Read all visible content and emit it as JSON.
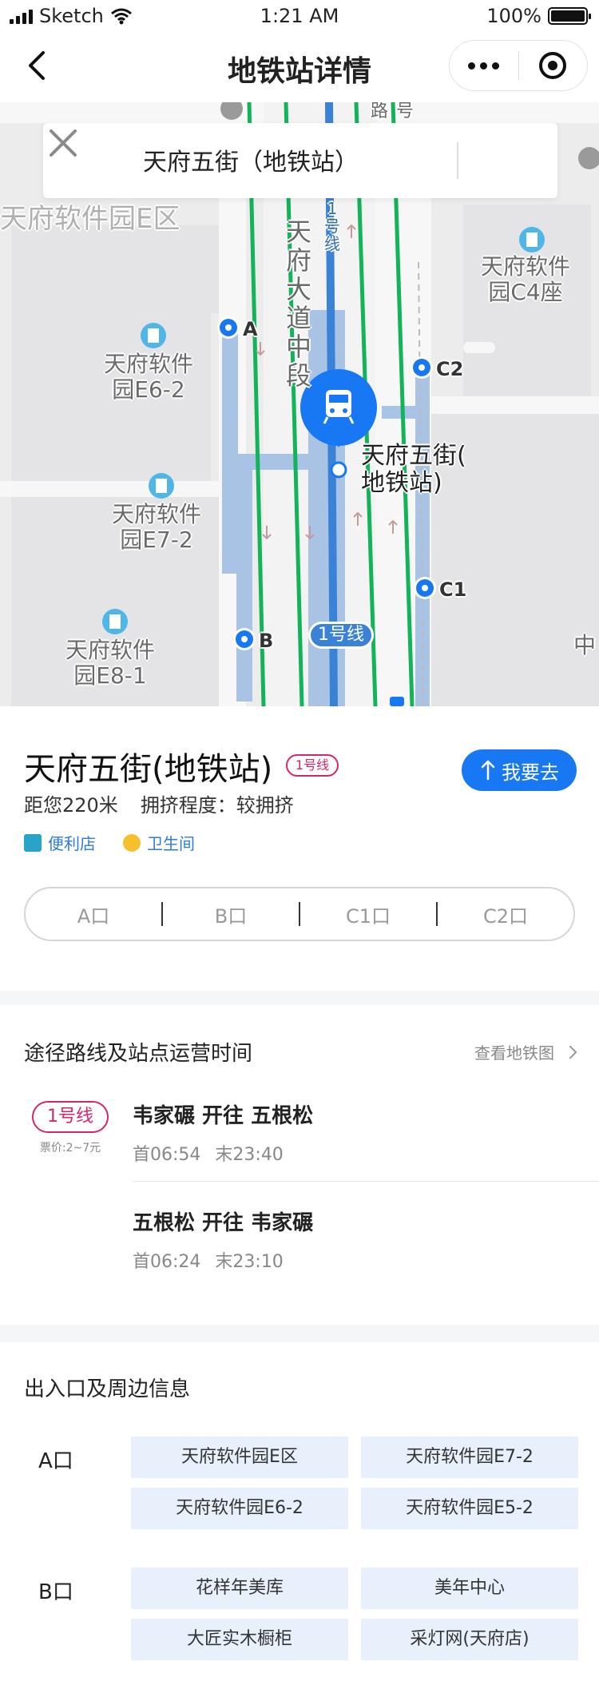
{
  "status_bar": {
    "carrier": "Sketch",
    "time": "1:21 AM",
    "battery": "100%"
  },
  "nav": {
    "title": "地铁站详情"
  },
  "map": {
    "search_text": "天府五街（地铁站）",
    "labels": {
      "park_e": "天府软件园E区",
      "c4": [
        "天府软件",
        "园C4座"
      ],
      "e6": [
        "天府软件",
        "园E6-2"
      ],
      "e7": [
        "天府软件",
        "园E7-2"
      ],
      "e8": [
        "天府软件",
        "园E8-1"
      ],
      "avenue": [
        "天",
        "府",
        "大",
        "道",
        "中",
        "段"
      ],
      "station": [
        "天府五街(",
        "地铁站)"
      ],
      "line_vertical": [
        "1",
        "号",
        "线"
      ],
      "road_top": [
        "路",
        "号"
      ],
      "edge_right": "中"
    },
    "exits": {
      "a": "A",
      "b": "B",
      "c1": "C1",
      "c2": "C2"
    },
    "line_tag": "1号线"
  },
  "station": {
    "name": "天府五街(地铁站)",
    "line_badge": "1号线",
    "go_label": "我要去",
    "distance": "距您220米",
    "crowd": "拥挤程度：较拥挤",
    "facilities": [
      "便利店",
      "卫生间"
    ],
    "exit_tabs": [
      "A口",
      "B口",
      "C1口",
      "C2口"
    ]
  },
  "routes": {
    "title": "途径路线及站点运营时间",
    "link": "查看地铁图",
    "line": "1号线",
    "fare": "票价:2~7元",
    "directions": [
      {
        "title": "韦家碾 开往 五根松",
        "first": "首06:54",
        "last": "末23:40"
      },
      {
        "title": "五根松 开往 韦家碾",
        "first": "首06:24",
        "last": "末23:10"
      }
    ]
  },
  "exits_info": {
    "title": "出入口及周边信息",
    "groups": [
      {
        "label": "A口",
        "pois": [
          "天府软件园E区",
          "天府软件园E7-2",
          "天府软件园E6-2",
          "天府软件园E5-2"
        ]
      },
      {
        "label": "B口",
        "pois": [
          "花样年美库",
          "美年中心",
          "大匠实木橱柜",
          "采灯网(天府店)"
        ]
      }
    ]
  },
  "colors": {
    "accent_blue": "#1877f2",
    "line1_red": "#d4266e",
    "map_line_blue": "#3a82d6",
    "road_green": "#13b35a",
    "poi_bg": "#e8f0fc"
  }
}
